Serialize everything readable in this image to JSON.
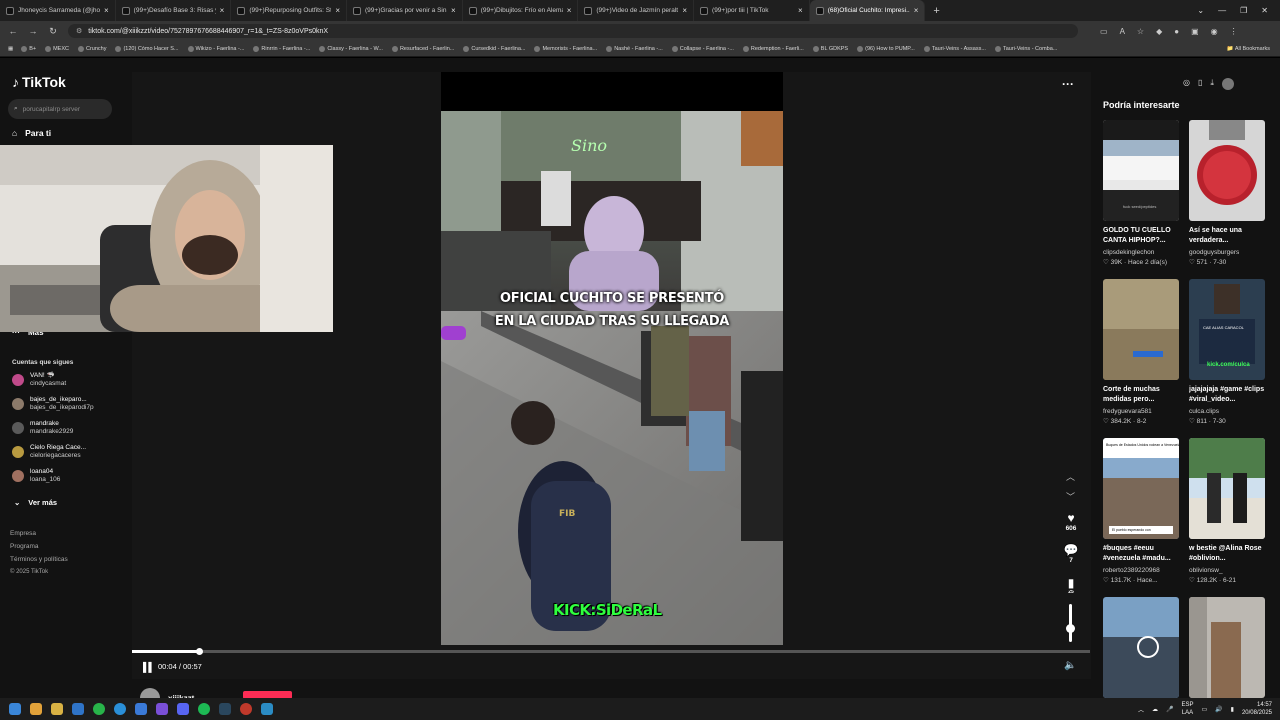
{
  "browser": {
    "tabs": [
      {
        "title": "Jhoneycis Sarrameda (@jhoneyci...",
        "active": false
      },
      {
        "title": "(99+)Desafío Base 3: Risas y Re...",
        "active": false
      },
      {
        "title": "(99+)Repurposing Outfits: Style...",
        "active": false
      },
      {
        "title": "(99+)Gracias por venir a SinSal...",
        "active": false
      },
      {
        "title": "(99+)Dibujitos: Frío en Alemán...",
        "active": false
      },
      {
        "title": "(99+)Video de Jazmín peralta (...",
        "active": false
      },
      {
        "title": "(99+)por tiii | TikTok",
        "active": false
      },
      {
        "title": "(68)Oficial Cuchito: Impresi...",
        "active": true
      }
    ],
    "new_tab": "+",
    "url": "tiktok.com/@xiiikzzt/video/7527897676688446907_r=1&_t=ZS-8z0oVPs0knX",
    "bookmarks": [
      "B+",
      "MEXC",
      "Crunchy",
      "(120) Cómo Hacer S...",
      "Wikizo - Faerlina -...",
      "Rinrrin - Faerlina -...",
      "Classy - Faerlina - W...",
      "Resurfaced - Faerlin...",
      "Cursedkid - Faerlina...",
      "Memorists - Faerlina...",
      "Nashé - Faerlina -...",
      "Collapse - Faerlina -...",
      "Redemption - Faerli...",
      "BL GDKPS",
      "(96) How to PUMP...",
      "Tauri-Veins - Assass...",
      "Tauri-Veins - Comba..."
    ],
    "all_bookmarks": "All Bookmarks"
  },
  "tiktok": {
    "logo": "TikTok",
    "search_placeholder": "porucapitalrp server",
    "nav_for_you": "Para ti",
    "nav_more": "Más",
    "following_title": "Cuentas que sigues",
    "following": [
      {
        "name": "VAN! 🦈",
        "user": "cindycasmat"
      },
      {
        "name": "bajes_de_ikeparo...",
        "user": "bajes_de_ikeparodi7p"
      },
      {
        "name": "mandrake",
        "user": "mandrake2929"
      },
      {
        "name": "Cielo Riega Cace...",
        "user": "cieloriegacaceres"
      },
      {
        "name": "loana04",
        "user": "loana_106"
      }
    ],
    "see_more": "Ver más",
    "footer": [
      "Empresa",
      "Programa",
      "Términos y políticas",
      "© 2025 TikTok"
    ]
  },
  "video": {
    "caption_line1": "OFICIAL CUCHITO SE PRESENTÓ",
    "caption_line2": "EN LA CIUDAD TRAS SU LLEGADA",
    "watermark": "KICK:SiDeRaL",
    "time": "00:04 / 00:57",
    "progress_fraction": 0.07,
    "likes": "606",
    "comments": "7",
    "saves": "25",
    "volume_fraction": 0.55,
    "author": "xiiikzzt"
  },
  "recommendations": {
    "title": "Podría interesarte",
    "cards": [
      {
        "title": "GOLDO TU CUELLO CANTA HIPHOP?...",
        "author": "clipsdekinglechon",
        "meta": "♡ 39K · Hace 2 día(s)"
      },
      {
        "title": "Así se hace una verdadera...",
        "author": "goodguysburgers",
        "meta": "♡ 571 · 7-30"
      },
      {
        "title": "Corte de muchas medidas pero...",
        "author": "fredyguevara581",
        "meta": "♡ 384.2K · 8-2"
      },
      {
        "title": "jajajajaja #game #clips #viral_video...",
        "author": "culca.clips",
        "meta": "♡ 811 · 7-30"
      },
      {
        "title": "#buques #eeuu #venezuela #madu...",
        "author": "roberto2389220968",
        "meta": "♡ 131.7K · Hace..."
      },
      {
        "title": "w bestie @Alina Rose #oblivion...",
        "author": "oblivionsw_",
        "meta": "♡ 128.2K · 6-21"
      },
      {
        "title": "",
        "author": "",
        "meta": ""
      },
      {
        "title": "",
        "author": "",
        "meta": ""
      }
    ],
    "thumb_texts": {
      "c1": "fuck seed/peptides",
      "c4a": "CAE ALIAS CARACOL",
      "c4b": "kick.com/culca",
      "c5a": "Buques de Estados Unidos rodean a Venezuela",
      "c5b": "El pueblo esperando con"
    }
  },
  "taskbar": {
    "lang": "ESP",
    "lang2": "LAA",
    "time": "14:57",
    "date": "20/08/2025"
  }
}
